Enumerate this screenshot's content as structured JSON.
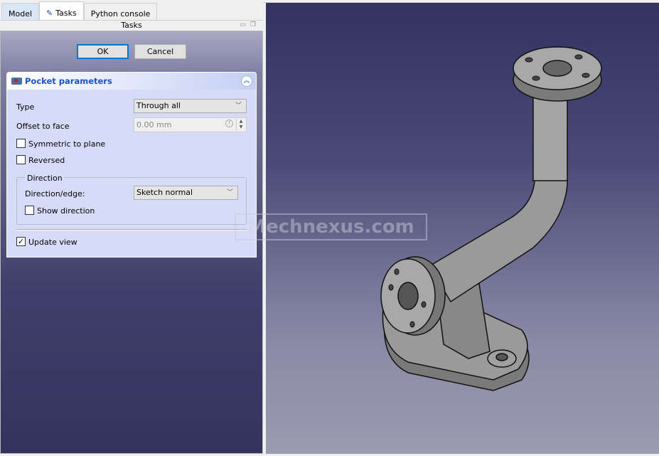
{
  "tabs": [
    {
      "label": "Model"
    },
    {
      "label": "Tasks",
      "icon": "pencil-icon"
    },
    {
      "label": "Python console"
    }
  ],
  "panel_title": "Tasks",
  "buttons": {
    "ok": "OK",
    "cancel": "Cancel"
  },
  "pocket": {
    "title": "Pocket parameters",
    "type_label": "Type",
    "type_value": "Through all",
    "offset_label": "Offset to face",
    "offset_value": "0.00 mm",
    "symmetric_label": "Symmetric to plane",
    "symmetric_checked": false,
    "reversed_label": "Reversed",
    "reversed_checked": false,
    "direction_group": "Direction",
    "direction_edge_label": "Direction/edge:",
    "direction_edge_value": "Sketch normal",
    "show_direction_label": "Show direction",
    "show_direction_checked": false,
    "update_view_label": "Update view",
    "update_view_checked": true
  },
  "watermark": "Mechnexus.com",
  "colors": {
    "accent": "#1e50c8",
    "viewport_top": "#33335f",
    "viewport_bottom": "#9a9ab0",
    "model": "#8a8a8a"
  }
}
